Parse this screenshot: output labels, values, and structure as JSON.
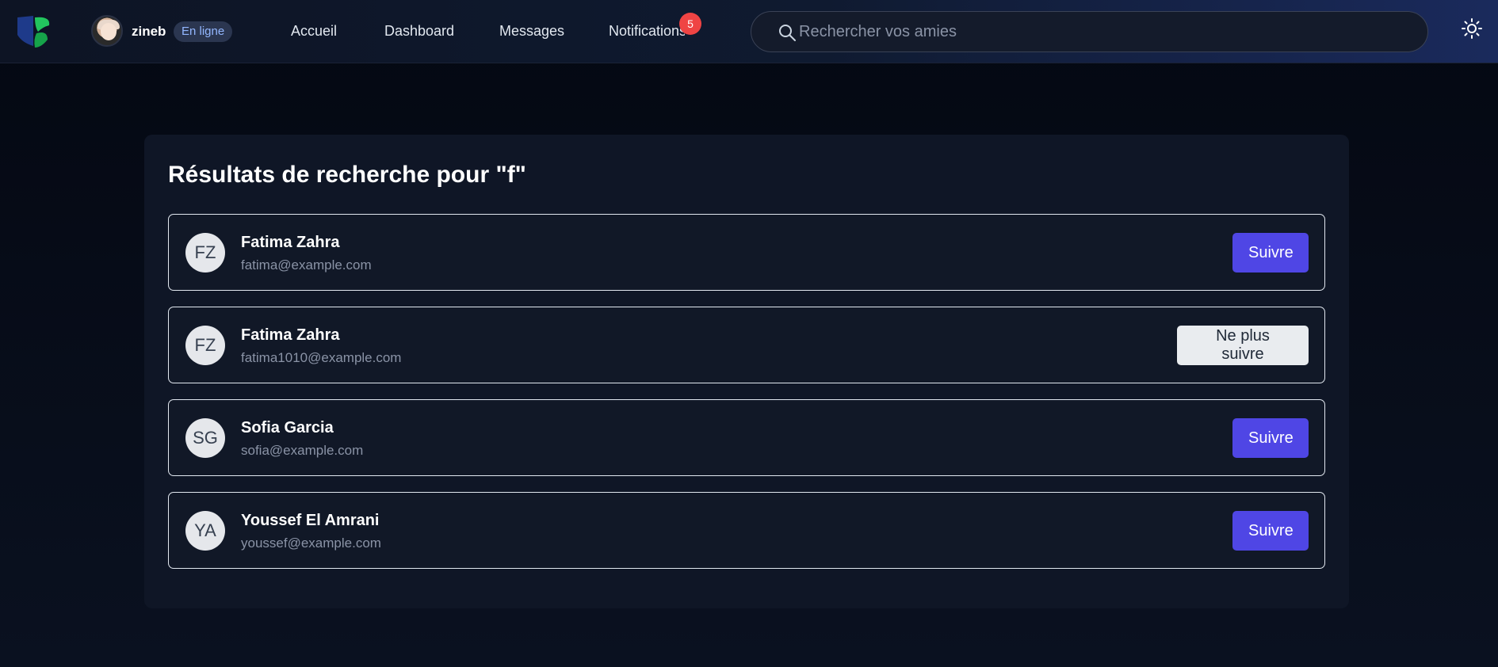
{
  "header": {
    "username": "zineb",
    "status": "En ligne",
    "nav": [
      "Accueil",
      "Dashboard",
      "Messages",
      "Notifications"
    ],
    "notification_count": "5",
    "search_placeholder": "Rechercher vos amies",
    "search_value": ""
  },
  "results": {
    "title": "Résultats de recherche pour \"f\"",
    "items": [
      {
        "initials": "FZ",
        "name": "Fatima Zahra",
        "email": "fatima@example.com",
        "action": "Suivre"
      },
      {
        "initials": "FZ",
        "name": "Fatima Zahra",
        "email": "fatima1010@example.com",
        "action": "Ne plus suivre"
      },
      {
        "initials": "SG",
        "name": "Sofia Garcia",
        "email": "sofia@example.com",
        "action": "Suivre"
      },
      {
        "initials": "YA",
        "name": "Youssef El Amrani",
        "email": "youssef@example.com",
        "action": "Suivre"
      }
    ]
  },
  "colors": {
    "accent": "#4f46e5",
    "badge": "#ef4444",
    "background": "#040812"
  },
  "icons": [
    "logo-icon",
    "avatar",
    "search-icon",
    "sun-icon"
  ]
}
